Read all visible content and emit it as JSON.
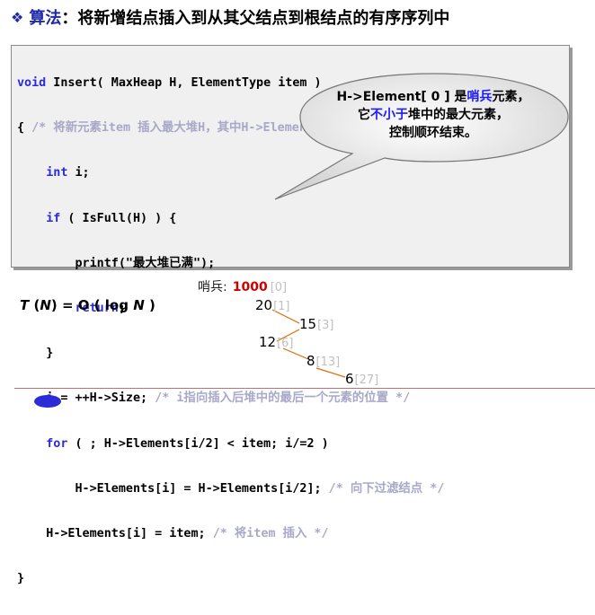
{
  "title": {
    "bullet": "❖",
    "label": "算法",
    "colon": "：",
    "text": "将新增结点插入到从其父结点到根结点的有序序列中"
  },
  "code": {
    "l1_kw": "void",
    "l1_rest": " Insert( MaxHeap H, ElementType item )",
    "l2_brace": "{ ",
    "l2_cm": "/* 将新元素item 插入最大堆H，其中H->Element[0]已经定义为哨兵 */",
    "l3_kw": "int",
    "l3_rest": " i;",
    "l4_kw": "if",
    "l4_rest": " ( IsFull(H) ) {",
    "l5": "printf(\"最大堆已满\");",
    "l6_kw": "return",
    "l6_rest": ";",
    "l7": "}",
    "l8_code": "i = ++H->Size; ",
    "l8_cm": "/* i指向插入后堆中的最后一个元素的位置 */",
    "l9_kw": "for",
    "l9_rest": " ( ; H->Elements[i/2] < item; i/=2 )",
    "l10_code": "H->Elements[i] = H->Elements[i/2]; ",
    "l10_cm": "/* 向下过滤结点 */",
    "l11_code": "H->Elements[i] = item; ",
    "l11_cm": "/* 将item 插入 */",
    "l12": "}"
  },
  "callout": {
    "line1_pre": "H->Element[ 0 ] 是",
    "line1_hl": "哨兵",
    "line1_post": "元素，",
    "line2_pre": "它",
    "line2_hl": "不小于",
    "line2_post": "堆中的最大元素，",
    "line3": "控制顺环结束。"
  },
  "sentinel": {
    "label": "哨兵:",
    "value": "1000",
    "index": "[0]"
  },
  "complexity": {
    "t": "T",
    "lp1": " (",
    "n1": "N",
    "mid": ") = O ( log ",
    "n2": "N",
    "rp": " )"
  },
  "tree": [
    {
      "value": "20",
      "index": "[1]"
    },
    {
      "value": "15",
      "index": "[3]"
    },
    {
      "value": "12",
      "index": "[6]"
    },
    {
      "value": "8",
      "index": "[13]"
    },
    {
      "value": "6",
      "index": "[27]"
    }
  ],
  "colors": {
    "keyword": "#2b2bd8",
    "comment": "#a8a8c8",
    "highlight": "#1a1aff",
    "sentinel_value": "#d00000",
    "tree_edge": "#e06a00"
  }
}
